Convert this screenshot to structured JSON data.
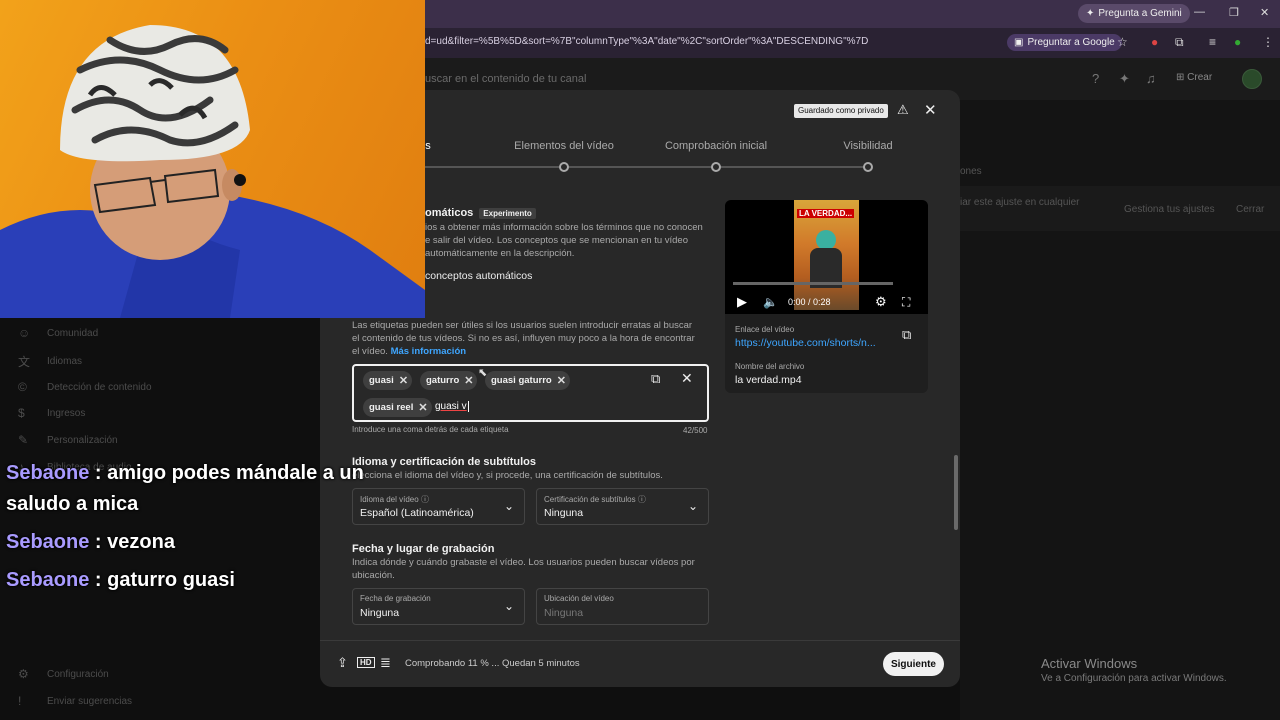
{
  "browser": {
    "url": "d=ud&filter=%5B%5D&sort=%7B\"columnType\"%3A\"date\"%2C\"sortOrder\"%3A\"DESCENDING\"%7D",
    "gemini_label": "Pregunta a Gemini",
    "google_label": "Preguntar a Google"
  },
  "studio_header": {
    "search_placeholder": "uscar en el contenido de tu canal",
    "create_label": "Crear"
  },
  "background": {
    "tabs_partial": "ones",
    "notice_partial": "iar este ajuste en cualquier",
    "manage_label": "Gestiona tus ajustes",
    "close_label": "Cerrar",
    "sidebar": [
      "Comunidad",
      "Idiomas",
      "Detección de contenido",
      "Ingresos",
      "Personalización",
      "Biblioteca de audio"
    ],
    "settings_label": "Configuración",
    "feedback_label": "Enviar sugerencias"
  },
  "modal": {
    "saved_chip": "Guardado como privado",
    "steps": [
      {
        "label": "es"
      },
      {
        "label": "Elementos del vídeo"
      },
      {
        "label": "Comprobación inicial"
      },
      {
        "label": "Visibilidad"
      }
    ],
    "concepts": {
      "title_partial": "omáticos",
      "badge": "Experimento",
      "body": [
        "ios a obtener más información sobre los términos que no conocen",
        "e salir del vídeo. Los conceptos que se mencionan en tu vídeo",
        "automáticamente en la descripción."
      ],
      "checkbox_label": "conceptos automáticos"
    },
    "tags": {
      "help_text": "Las etiquetas pueden ser útiles si los usuarios suelen introducir erratas al buscar el contenido de tus vídeos. Si no es así, influyen muy poco a la hora de encontrar el vídeo.",
      "more_info": "Más información",
      "chips": [
        "guasi",
        "gaturro",
        "guasi gaturro",
        "guasi reel"
      ],
      "input_value": "guasi v",
      "hint": "Introduce una coma detrás de cada etiqueta",
      "count": "42/500"
    },
    "language": {
      "title": "Idioma y certificación de subtítulos",
      "desc": "elecciona el idioma del vídeo y, si procede, una certificación de subtítulos.",
      "video_lang_label": "Idioma del vídeo",
      "video_lang_value": "Español (Latinoamérica)",
      "cert_label": "Certificación de subtítulos",
      "cert_value": "Ninguna"
    },
    "recording": {
      "title": "Fecha y lugar de grabación",
      "desc": "Indica dónde y cuándo grabaste el vídeo. Los usuarios pueden buscar vídeos por ubicación.",
      "date_label": "Fecha de grabación",
      "date_value": "Ninguna",
      "location_label": "Ubicación del vídeo",
      "location_placeholder": "Ninguna"
    },
    "video_card": {
      "thumb_text": "LA VERDAD...",
      "time": "0:00 / 0:28",
      "link_label": "Enlace del vídeo",
      "link_value": "https://youtube.com/shorts/n...",
      "filename_label": "Nombre del archivo",
      "filename_value": "la verdad.mp4"
    },
    "footer": {
      "status": "Comprobando 11 % ... Quedan 5 minutos",
      "next_label": "Siguiente"
    }
  },
  "chat": [
    {
      "user": "Sebaone",
      "message": ": amigo podes mándale a un",
      "continuation": "saludo a mica"
    },
    {
      "user": "Sebaone",
      "message": ": vezona"
    },
    {
      "user": "Sebaone",
      "message": ": gaturro guasi"
    }
  ],
  "activate_windows": {
    "title": "Activar Windows",
    "subtitle": "Ve a Configuración para activar Windows."
  },
  "colors": {
    "accent": "#3ea6ff",
    "chat_user": "#a99bff",
    "modal_bg": "#282828"
  }
}
